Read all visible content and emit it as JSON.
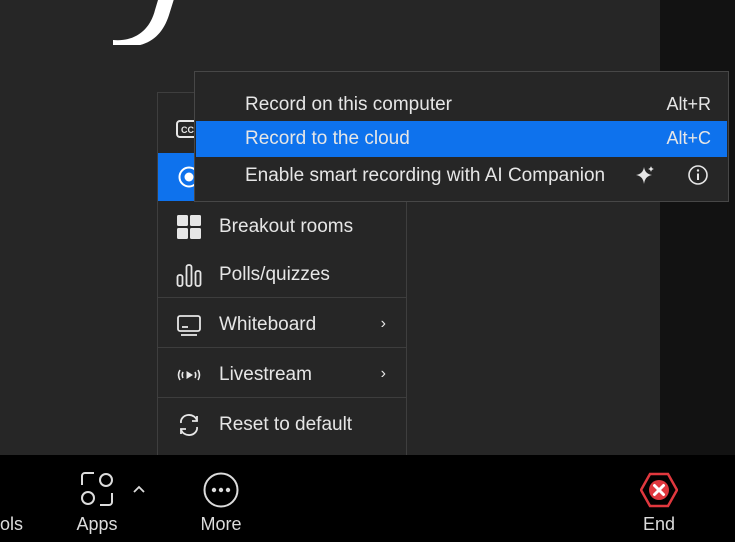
{
  "more_menu": {
    "items": [
      {
        "label": ""
      },
      {
        "label": ""
      },
      {
        "label": "Breakout rooms"
      },
      {
        "label": "Polls/quizzes"
      },
      {
        "label": "Whiteboard",
        "chevron": "›"
      },
      {
        "label": "Livestream",
        "chevron": "›"
      },
      {
        "label": "Reset to default"
      }
    ]
  },
  "record_submenu": {
    "items": [
      {
        "label": "Record on this computer",
        "shortcut": "Alt+R"
      },
      {
        "label": "Record to the cloud",
        "shortcut": "Alt+C",
        "selected": true
      },
      {
        "label": "Enable smart recording with AI Companion",
        "icons": [
          "sparkle-icon",
          "info-icon"
        ]
      }
    ]
  },
  "toolbar": {
    "tools_label": "ols",
    "apps_label": "Apps",
    "more_label": "More",
    "end_label": "End"
  },
  "colors": {
    "accent": "#0e72ed",
    "end": "#e0383e",
    "menu_bg": "#262626",
    "toolbar_bg": "#000000"
  }
}
